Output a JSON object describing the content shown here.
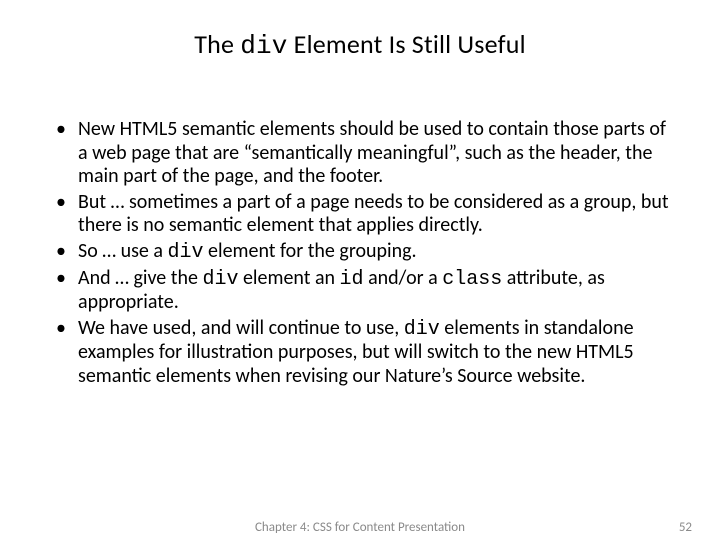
{
  "title": {
    "pre": "The ",
    "code": "div",
    "post": " Element Is Still Useful"
  },
  "bullets": [
    {
      "segments": [
        {
          "t": "New HTML5 semantic elements should be used to contain those parts of a web page that are “semantically meaningful”, such as the header, the main part of the page, and the footer."
        }
      ]
    },
    {
      "segments": [
        {
          "t": "But … sometimes a part of a page needs to be considered as a group, but there is no semantic element that applies directly."
        }
      ]
    },
    {
      "segments": [
        {
          "t": "So … use a "
        },
        {
          "t": "div",
          "mono": true
        },
        {
          "t": " element for the grouping."
        }
      ]
    },
    {
      "segments": [
        {
          "t": "And … give the "
        },
        {
          "t": "div",
          "mono": true
        },
        {
          "t": " element an "
        },
        {
          "t": "id",
          "mono": true
        },
        {
          "t": " and/or a "
        },
        {
          "t": "class",
          "mono": true
        },
        {
          "t": " attribute, as appropriate."
        }
      ]
    },
    {
      "segments": [
        {
          "t": "We have used, and will continue to use, "
        },
        {
          "t": "div",
          "mono": true
        },
        {
          "t": " elements in standalone examples for illustration purposes, but will switch to the new HTML5 semantic elements when revising our Nature’s Source website."
        }
      ]
    }
  ],
  "footer": {
    "chapter": "Chapter 4: CSS for Content Presentation",
    "page": "52"
  }
}
